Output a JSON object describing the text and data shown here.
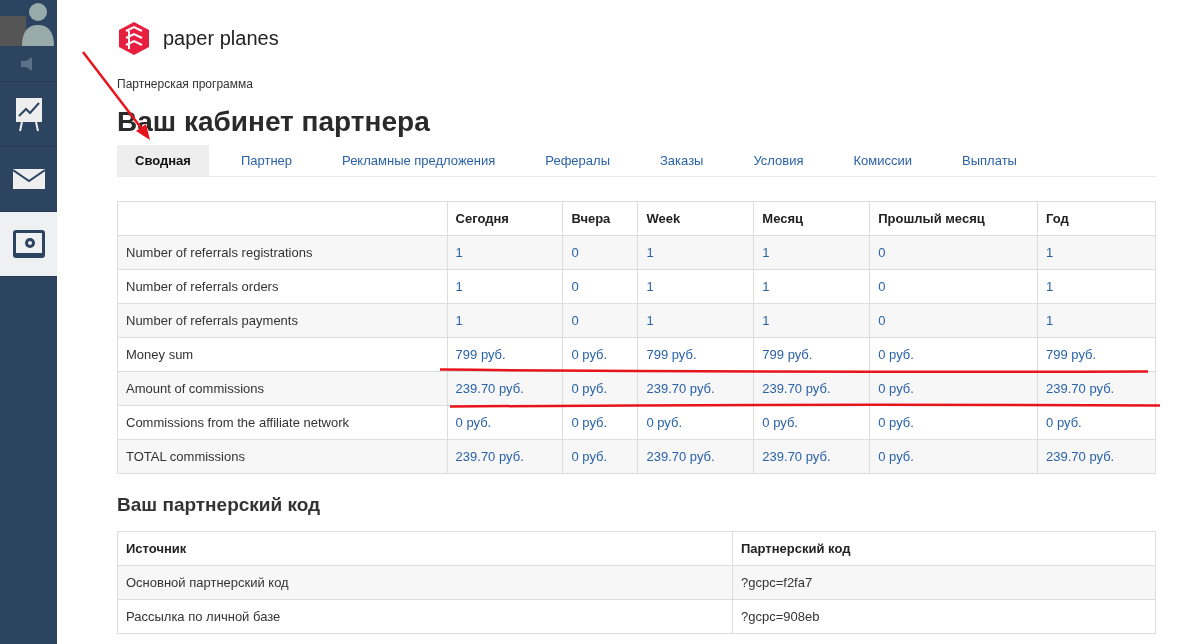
{
  "sidebar": {
    "items": [
      {
        "kind": "avatar",
        "selected": false
      },
      {
        "kind": "sound",
        "selected": false
      },
      {
        "kind": "chart",
        "selected": false
      },
      {
        "kind": "mail",
        "selected": false
      },
      {
        "kind": "safe",
        "selected": true
      }
    ]
  },
  "logo": {
    "text": "paper planes"
  },
  "breadcrumb": "Партнерская программа",
  "title": "Ваш кабинет партнера",
  "tabs": [
    {
      "label": "Сводная",
      "selected": true
    },
    {
      "label": "Партнер",
      "selected": false
    },
    {
      "label": "Рекламные предложения",
      "selected": false
    },
    {
      "label": "Рефералы",
      "selected": false
    },
    {
      "label": "Заказы",
      "selected": false
    },
    {
      "label": "Условия",
      "selected": false
    },
    {
      "label": "Комиссии",
      "selected": false
    },
    {
      "label": "Выплаты",
      "selected": false
    }
  ],
  "stats_table": {
    "columns": [
      "",
      "Сегодня",
      "Вчера",
      "Week",
      "Месяц",
      "Прошлый месяц",
      "Год"
    ],
    "rows": [
      [
        "Number of referrals registrations",
        "1",
        "0",
        "1",
        "1",
        "0",
        "1"
      ],
      [
        "Number of referrals orders",
        "1",
        "0",
        "1",
        "1",
        "0",
        "1"
      ],
      [
        "Number of referrals payments",
        "1",
        "0",
        "1",
        "1",
        "0",
        "1"
      ],
      [
        "Money sum",
        "799 руб.",
        "0 руб.",
        "799 руб.",
        "799 руб.",
        "0 руб.",
        "799 руб."
      ],
      [
        "Amount of commissions",
        "239.70 руб.",
        "0 руб.",
        "239.70 руб.",
        "239.70 руб.",
        "0 руб.",
        "239.70 руб."
      ],
      [
        "Commissions from the affiliate network",
        "0 руб.",
        "0 руб.",
        "0 руб.",
        "0 руб.",
        "0 руб.",
        "0 руб."
      ],
      [
        "TOTAL commissions",
        "239.70 руб.",
        "0 руб.",
        "239.70 руб.",
        "239.70 руб.",
        "0 руб.",
        "239.70 руб."
      ]
    ]
  },
  "code_section": {
    "title": "Ваш партнерский код",
    "columns": [
      "Источник",
      "Партнерский код"
    ],
    "rows": [
      [
        "Основной партнерский код",
        "?gcpc=f2fa7"
      ],
      [
        "Рассылка по личной базе",
        "?gcpc=908eb"
      ]
    ]
  }
}
